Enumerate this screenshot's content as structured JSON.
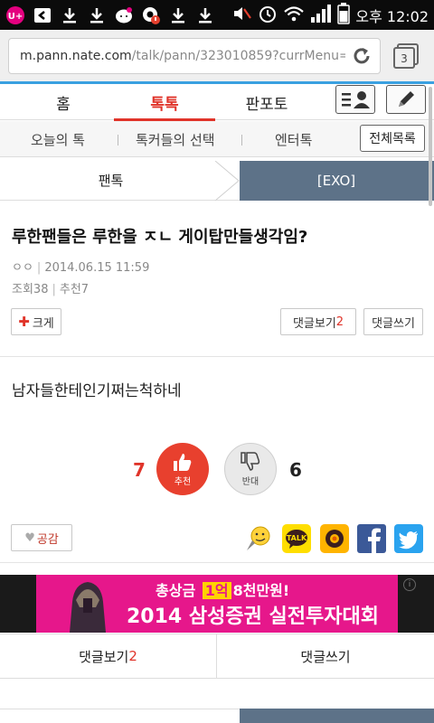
{
  "status_bar": {
    "time": "오후 12:02",
    "app_badge": "U+"
  },
  "browser": {
    "url_host": "m.pann.nate.com",
    "url_path": "/talk/pann/323010859?currMenu=",
    "tab_count": "3"
  },
  "main_nav": {
    "home": "홈",
    "talk": "톡톡",
    "pantos": "판포토"
  },
  "sub_nav": {
    "today": "오늘의 톡",
    "choice": "톡커들의 선택",
    "enter": "엔터톡",
    "all": "전체목록"
  },
  "breadcrumb": {
    "left": "팬톡",
    "right": "[EXO]"
  },
  "post": {
    "title": "루한팬들은 루한을 ㅈㄴ 게이탑만들생각임?",
    "author": "ㅇㅇ",
    "date": "2014.06.15 11:59",
    "views_label": "조회",
    "views": "38",
    "recommend_label": "추천",
    "recommend": "7",
    "body": "남자들한테인기쩌는척하네"
  },
  "actions": {
    "bigger": "크게",
    "comments_label": "댓글보기",
    "comments_count": "2",
    "write_comment": "댓글쓰기"
  },
  "votes": {
    "up_count": "7",
    "up_label": "추천",
    "down_count": "6",
    "down_label": "반대"
  },
  "share": {
    "empathy": "공감",
    "icons": [
      "emoticon-icon",
      "kakaotalk-icon",
      "kakaostory-icon",
      "facebook-icon",
      "twitter-icon"
    ],
    "kakao_text": "TALK"
  },
  "ad": {
    "line1_prefix": "총상금",
    "line1_badge": "1억",
    "line1_rest": "8천만원!",
    "line2": "2014 삼성증권 실전투자대회"
  },
  "bottom": {
    "comments_label": "댓글보기",
    "comments_count": "2",
    "write_comment": "댓글쓰기"
  },
  "colors": {
    "accent_red": "#e0342a",
    "nav_blue": "#5d7288",
    "ad_pink": "#e6178b"
  }
}
